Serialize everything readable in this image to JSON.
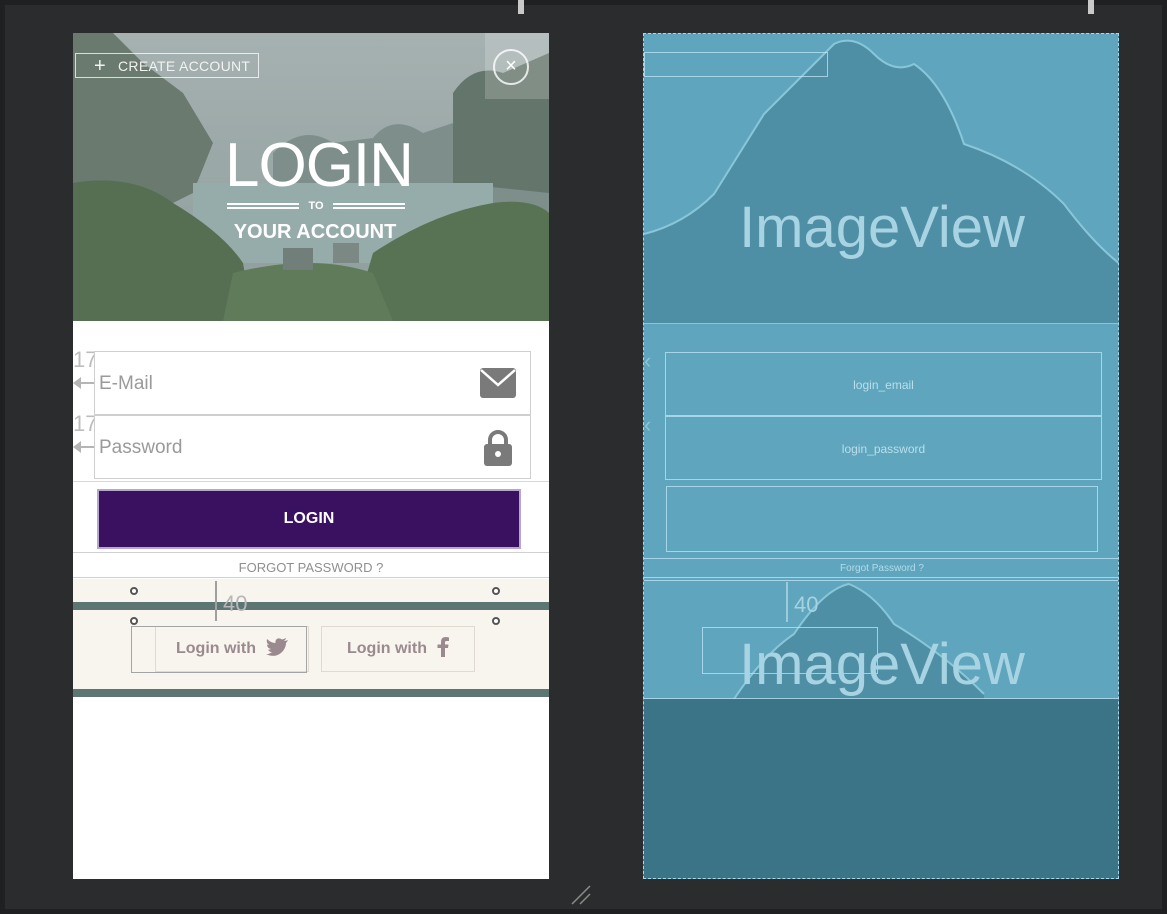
{
  "design_preview": {
    "create_account_label": "CREATE ACCOUNT",
    "title": "LOGIN",
    "to_text": "TO",
    "subtitle": "YOUR ACCOUNT",
    "email_placeholder": "E-Mail",
    "password_placeholder": "Password",
    "login_button": "LOGIN",
    "forgot_password": "FORGOT PASSWORD ?",
    "twitter_button": "Login with",
    "facebook_button": "Login with",
    "margin_marker": "17",
    "dimension_label": "40"
  },
  "blueprint": {
    "top_image_label": "ImageView",
    "email_id": "login_email",
    "password_id": "login_password",
    "forgot_password": "Forgot Password ?",
    "dimension_label": "40",
    "bottom_image_label": "ImageView"
  },
  "colors": {
    "login_button": "#3a1060",
    "blueprint_bg": "#3d7d91",
    "social_band": "#f8f4ee",
    "band_bar": "#5d7673"
  },
  "icons": [
    "plus-icon",
    "close-icon",
    "mail-icon",
    "lock-icon",
    "twitter-icon",
    "facebook-icon"
  ]
}
